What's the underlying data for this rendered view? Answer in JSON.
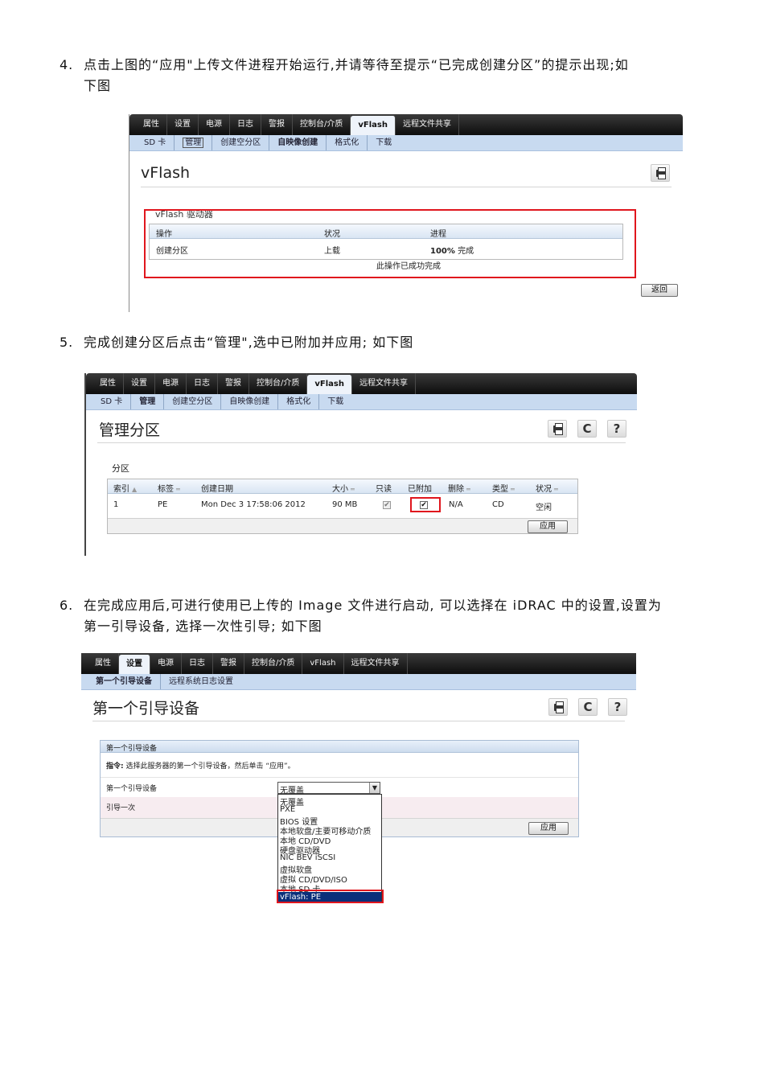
{
  "steps": [
    {
      "number": "4.",
      "line1": "点击上图的“应用\"上传文件进程开始运行,并请等待至提示“已完成创建分区”的提示出现;如",
      "line2": "下图"
    },
    {
      "number": "5.",
      "line1": "完成创建分区后点击“管理\",选中已附加并应用; 如下图"
    },
    {
      "number": "6.",
      "line1": "在完成应用后,可进行使用已上传的 Image 文件进行启动, 可以选择在 iDRAC 中的设置,设置为",
      "line2": "第一引导设备, 选择一次性引导; 如下图"
    }
  ],
  "shot1": {
    "tabs": [
      "属性",
      "设置",
      "电源",
      "日志",
      "警报",
      "控制台/介质",
      "vFlash",
      "远程文件共享"
    ],
    "subtabs": [
      "SD 卡",
      "管理",
      "创建空分区",
      "自映像创建",
      "格式化",
      "下载"
    ],
    "title": "vFlash",
    "group_label": "vFlash 驱动器",
    "columns": [
      "操作",
      "状况",
      "进程"
    ],
    "row": {
      "operation": "创建分区",
      "status": "上载",
      "progress_bold": "100%",
      "progress_rest": " 完成"
    },
    "message": "此操作已成功完成",
    "back_button": "返回"
  },
  "shot2": {
    "tabs": [
      "属性",
      "设置",
      "电源",
      "日志",
      "警报",
      "控制台/介质",
      "vFlash",
      "远程文件共享"
    ],
    "subtabs": [
      "SD 卡",
      "管理",
      "创建空分区",
      "自映像创建",
      "格式化",
      "下载"
    ],
    "title": "管理分区",
    "section": "分区",
    "columns": [
      "索引",
      "标签",
      "创建日期",
      "大小",
      "只读",
      "已附加",
      "删除",
      "类型",
      "状况"
    ],
    "row": {
      "index": "1",
      "label": "PE",
      "date": "Mon Dec 3 17:58:06 2012",
      "size": "90 MB",
      "delete": "N/A",
      "type": "CD",
      "status": "空闲"
    },
    "apply_button": "应用"
  },
  "shot3": {
    "tabs": [
      "属性",
      "设置",
      "电源",
      "日志",
      "警报",
      "控制台/介质",
      "vFlash",
      "远程文件共享"
    ],
    "subtabs": [
      "第一个引导设备",
      "远程系统日志设置"
    ],
    "title": "第一个引导设备",
    "panel_title": "第一个引导设备",
    "instruction_bold": "指令:",
    "instruction": " 选择此服务器的第一个引导设备，然后单击 “应用”。",
    "field_label": "第一个引导设备",
    "boot_once_label": "引导一次",
    "selected": "无覆盖",
    "options": [
      "无覆盖",
      "PXE",
      "BIOS 设置",
      "本地软盘/主要可移动介质",
      "本地 CD/DVD",
      "硬盘驱动器",
      "NIC BEV iSCSI",
      "虚拟软盘",
      "虚拟 CD/DVD/ISO",
      "本地 SD 卡",
      "vFlash: PE"
    ],
    "apply_button": "应用"
  }
}
